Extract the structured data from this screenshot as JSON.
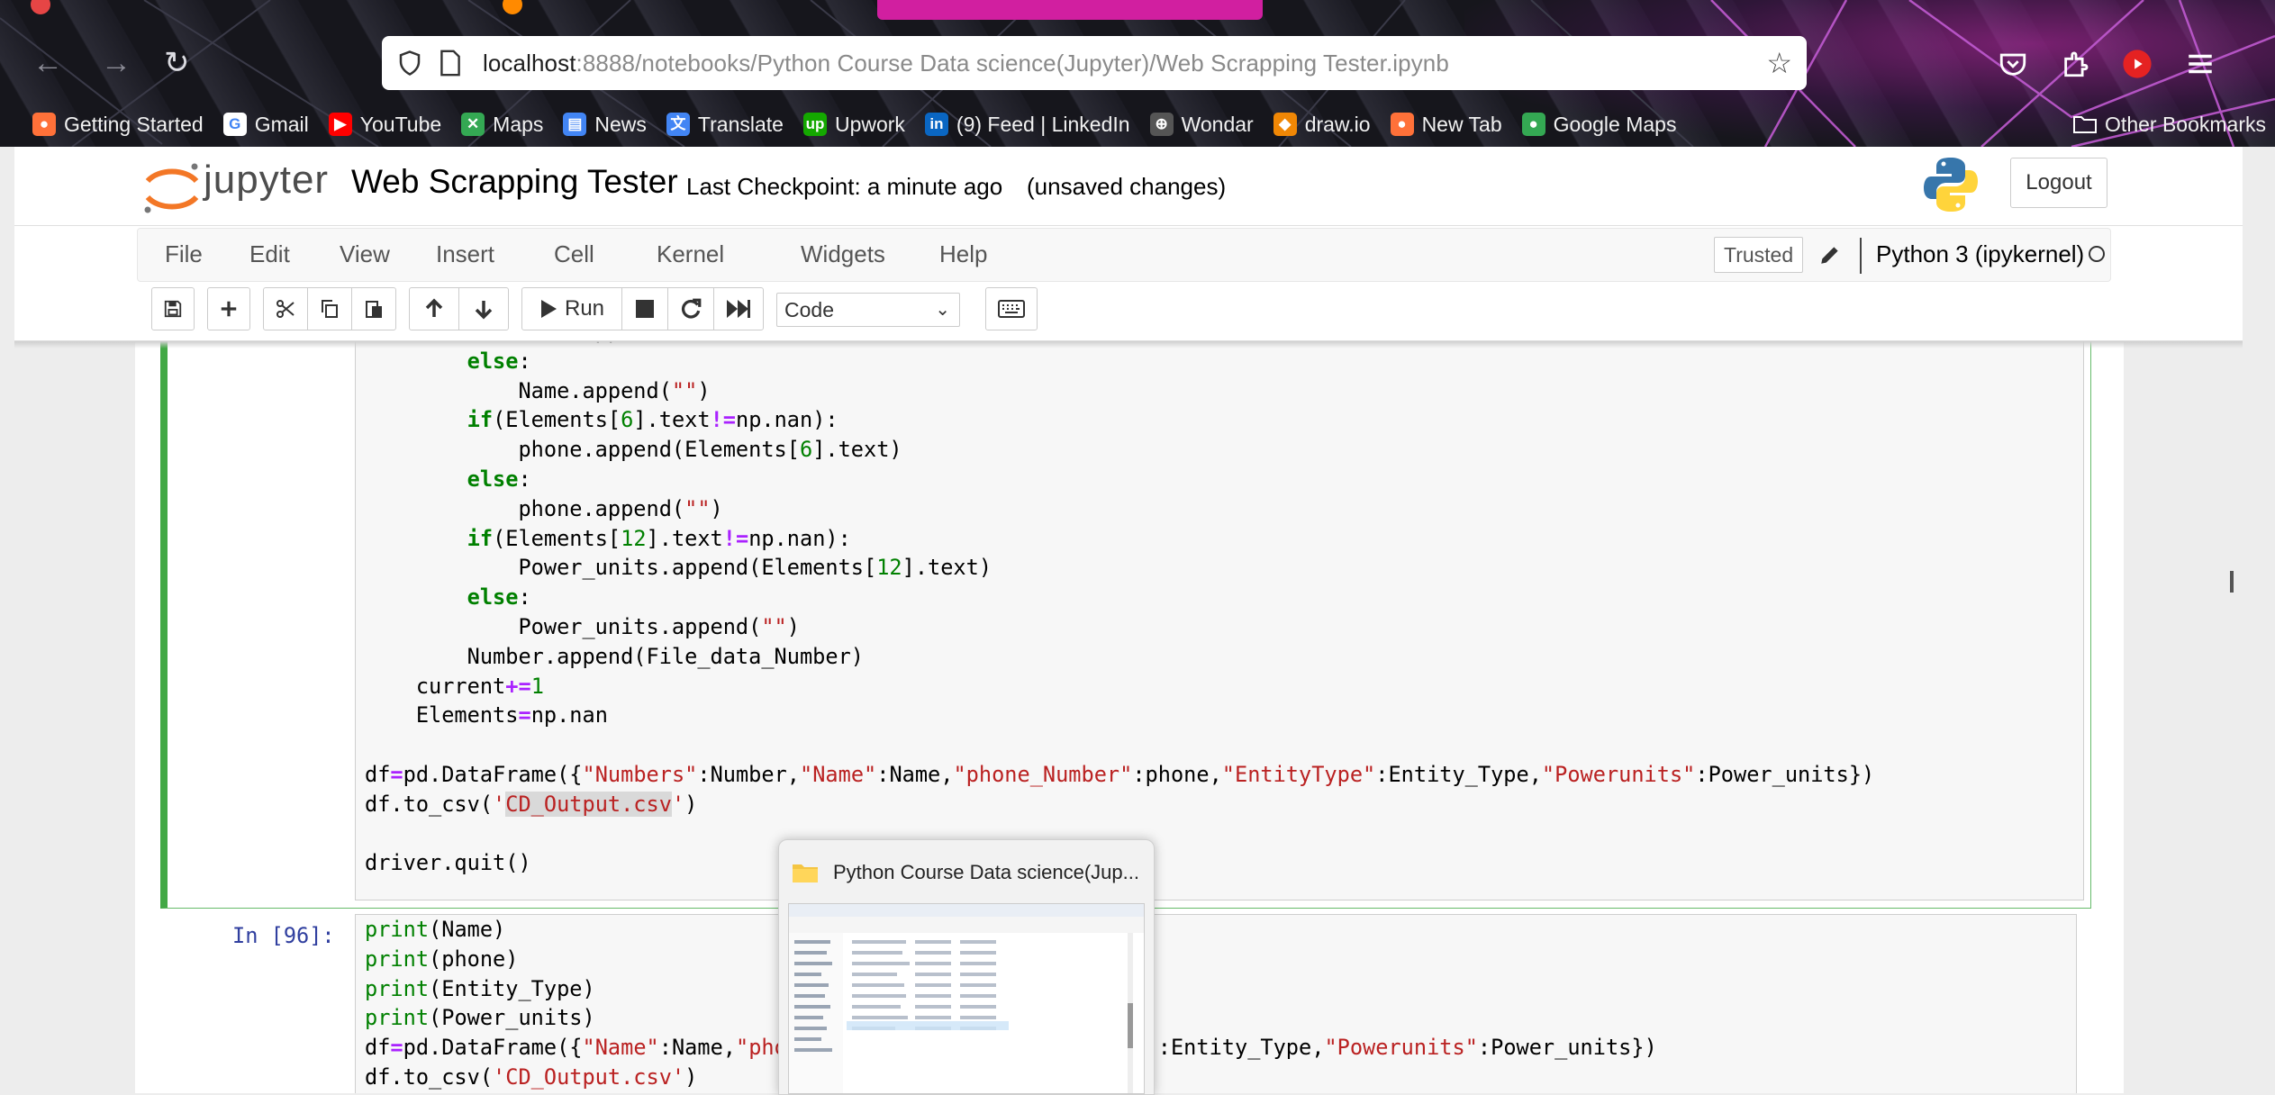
{
  "browser": {
    "url_host": "localhost",
    "url_path": ":8888/notebooks/Python Course Data science(Jupyter)/Web Scrapping Tester.ipynb",
    "bookmarks": [
      {
        "label": "Getting Started",
        "icon": "firefox-icon",
        "color": "#ff7139"
      },
      {
        "label": "Gmail",
        "icon": "google-icon",
        "color": "#ffffff"
      },
      {
        "label": "YouTube",
        "icon": "youtube-icon",
        "color": "#ff0000"
      },
      {
        "label": "Maps",
        "icon": "maps-icon",
        "color": "#34a853"
      },
      {
        "label": "News",
        "icon": "news-icon",
        "color": "#4285f4"
      },
      {
        "label": "Translate",
        "icon": "translate-icon",
        "color": "#4285f4"
      },
      {
        "label": "Upwork",
        "icon": "upwork-icon",
        "color": "#14a800"
      },
      {
        "label": "(9) Feed | LinkedIn",
        "icon": "linkedin-icon",
        "color": "#0a66c2"
      },
      {
        "label": "Wondar",
        "icon": "globe-icon",
        "color": "#555555"
      },
      {
        "label": "draw.io",
        "icon": "drawio-icon",
        "color": "#f08705"
      },
      {
        "label": "New Tab",
        "icon": "firefox-icon",
        "color": "#ff7139"
      },
      {
        "label": "Google Maps",
        "icon": "google-maps-icon",
        "color": "#34a853"
      }
    ],
    "other_bookmarks": "Other Bookmarks"
  },
  "jupyter": {
    "logo_text": "jupyter",
    "notebook_title": "Web Scrapping Tester",
    "checkpoint": "Last Checkpoint: a minute ago",
    "unsaved": "(unsaved changes)",
    "logout": "Logout"
  },
  "menu": {
    "items": [
      "File",
      "Edit",
      "View",
      "Insert",
      "Cell",
      "Kernel",
      "Widgets",
      "Help"
    ],
    "trusted": "Trusted",
    "kernel": "Python 3 (ipykernel)"
  },
  "toolbar": {
    "run_label": "Run",
    "cell_type": "Code"
  },
  "cells": {
    "cell2_prompt": "In [96]:"
  },
  "preview": {
    "title": "Python Course Data science(Jup..."
  },
  "colors": {
    "selected_cell_border": "#42a845",
    "prompt": "#303f9f",
    "keyword": "#008000",
    "string": "#ba2121",
    "operator": "#aa22ff"
  }
}
